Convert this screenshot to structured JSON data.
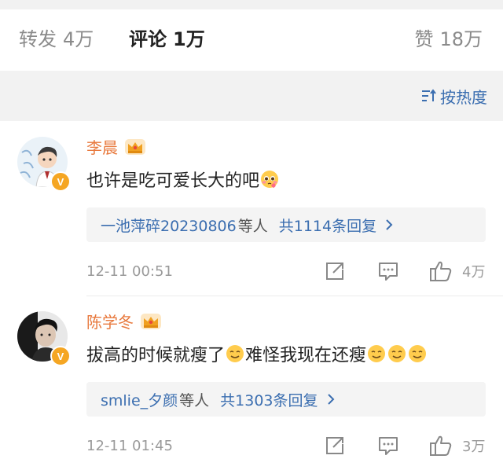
{
  "tabs": {
    "repost": {
      "label": "转发",
      "count": "4万"
    },
    "comment": {
      "label": "评论",
      "count": "1万"
    },
    "like": {
      "label": "赞",
      "count": "18万"
    }
  },
  "sort": {
    "label": "按热度",
    "icon": "sort-icon"
  },
  "comments": [
    {
      "username": "李晨",
      "text": "也许是吃可爱长大的吧",
      "emoji": "pleading-face-emoji",
      "reply_users": "一池萍碎20230806",
      "reply_etc": "等人",
      "reply_count": "共1114条回复",
      "time": "12-11 00:51",
      "likes": "4万"
    },
    {
      "username": "陈学冬",
      "text_part1": "拔高的时候就瘦了",
      "text_part2": "难怪我现在还瘦",
      "emoji": "smiling-face-emoji",
      "reply_users": "smlie_夕颜",
      "reply_etc": "等人",
      "reply_count": "共1303条回复",
      "time": "12-11 01:45",
      "likes": "3万"
    }
  ],
  "colors": {
    "username": "#e8793d",
    "link": "#3b6eb0",
    "muted": "#9a9a9a",
    "badge": "#f5a623"
  }
}
